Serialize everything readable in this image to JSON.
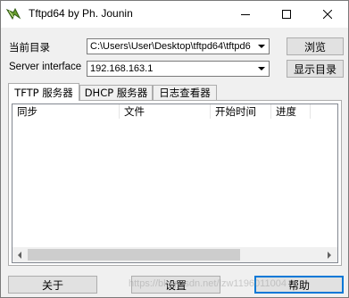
{
  "window": {
    "title": "Tftpd64 by Ph. Jounin",
    "icon": "tftpd-app-icon"
  },
  "titlebar_buttons": {
    "minimize": "minimize-icon",
    "maximize": "maximize-icon",
    "close": "close-icon"
  },
  "current_dir": {
    "label": "当前目录",
    "value": "C:\\Users\\User\\Desktop\\tftpd64\\tftpd6",
    "browse_button": "浏览"
  },
  "server_interface": {
    "label": "Server interface",
    "value": "192.168.163.1",
    "show_dir_button": "显示目录"
  },
  "tabs": [
    {
      "label": "TFTP 服务器",
      "active": true
    },
    {
      "label": "DHCP 服务器",
      "active": false
    },
    {
      "label": "日志查看器",
      "active": false
    }
  ],
  "list": {
    "columns": [
      "同步",
      "文件",
      "开始时间",
      "进度"
    ],
    "rows": []
  },
  "bottom_buttons": {
    "about": "关于",
    "settings": "设置",
    "help": "帮助"
  },
  "watermark": "https://blog.csdn.net/lzw1196011004"
}
